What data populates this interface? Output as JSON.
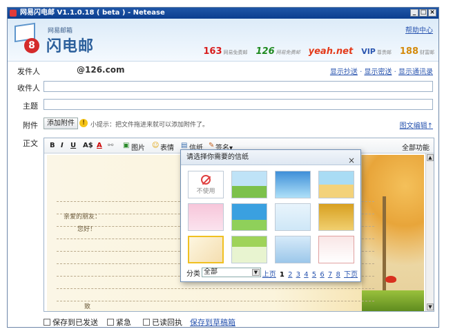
{
  "window": {
    "title": "网易闪电邮 V1.1.0.18 ( beta ) - Netease",
    "btn_min": "_",
    "btn_max": "□",
    "btn_close": "×"
  },
  "header": {
    "logo_sub": "网易邮箱",
    "logo_title": "闪电邮",
    "logo_badge": "8",
    "help": "帮助中心",
    "brands": [
      {
        "name": "163",
        "tag": "网易免费邮"
      },
      {
        "name": "126",
        "tag": "网易免费邮"
      },
      {
        "name": "yeah.net",
        "tag": ""
      },
      {
        "name": "VIP",
        "tag": "尊贵邮"
      },
      {
        "name": "188",
        "tag": "财富邮"
      }
    ]
  },
  "compose": {
    "from_label": "发件人",
    "from_value": "@126.com",
    "from_links": [
      "显示抄送",
      "显示密送",
      "显示通讯录"
    ],
    "to_label": "收件人",
    "subject_label": "主题",
    "attach_label": "附件",
    "attach_button": "添加附件",
    "attach_tip": "小提示：把文件拖进来就可以添加附件了。",
    "attach_right": "图文编辑↑",
    "body_label": "正文"
  },
  "toolbar": {
    "bold": "B",
    "italic": "I",
    "underline": "U",
    "fontsize": "A$",
    "fontcolor": "A",
    "image": "图片",
    "emoji": "表情",
    "stationery": "信纸",
    "signature": "签名▾",
    "all_functions": "全部功能"
  },
  "body_text": {
    "greeting": "亲爱的朋友：",
    "hello": "您好！",
    "closing": "致"
  },
  "footer": {
    "save_sent": "保存到已发送",
    "urgent": "紧急",
    "read_receipt": "已读回执",
    "save_draft": "保存到草稿箱"
  },
  "popup": {
    "title": "请选择你需要的信纸",
    "close": "×",
    "no_use": "不使用",
    "category_label": "分类",
    "category_value": "全部",
    "prev": "上页",
    "pages": [
      "1",
      "2",
      "3",
      "4",
      "5",
      "6",
      "7",
      "8"
    ],
    "current_page": "1",
    "next": "下页"
  },
  "colors": {
    "titlebar": "#1f56a7",
    "link": "#2b56b0",
    "accent_red": "#d42b2b"
  },
  "icons": [
    "app-icon",
    "envelope-icon",
    "tip-icon",
    "image-icon",
    "emoji-icon",
    "stationery-icon",
    "signature-icon",
    "close-icon",
    "dropdown-arrow-icon",
    "ban-icon"
  ]
}
